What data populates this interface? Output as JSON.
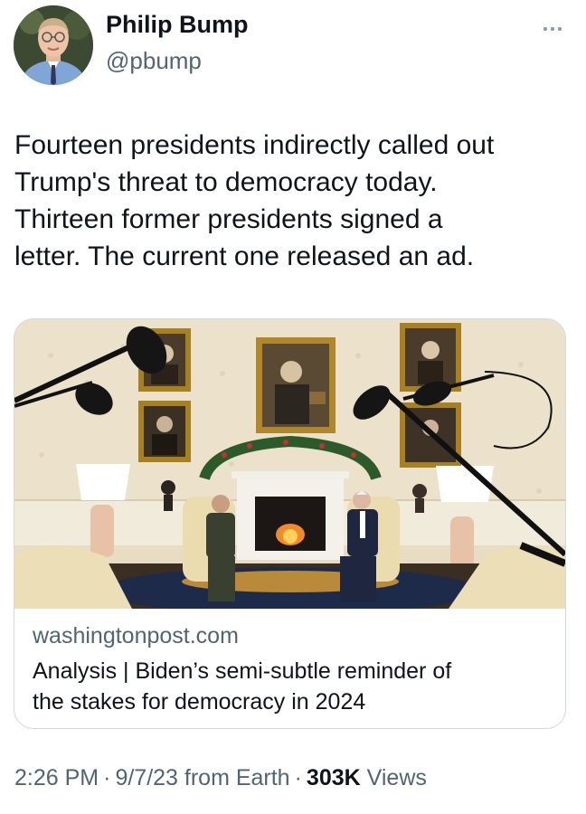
{
  "author": {
    "name": "Philip Bump",
    "handle": "@pbump"
  },
  "tweet": {
    "text_lines": [
      "Fourteen presidents indirectly called out",
      "Trump's threat to democracy today.",
      "Thirteen former presidents signed a",
      "letter. The current one released an ad."
    ]
  },
  "card": {
    "domain": "washingtonpost.com",
    "title_lines": [
      "Analysis | Biden’s semi-subtle reminder of",
      "the stakes for democracy in 2024"
    ]
  },
  "meta": {
    "time": "2:26 PM",
    "separator": "·",
    "date_source": "9/7/23 from Earth",
    "views_count": "303K",
    "views_label": "Views"
  },
  "colors": {
    "primary_text": "#0f1419",
    "secondary_text": "#536471",
    "border": "#cfd9de"
  }
}
